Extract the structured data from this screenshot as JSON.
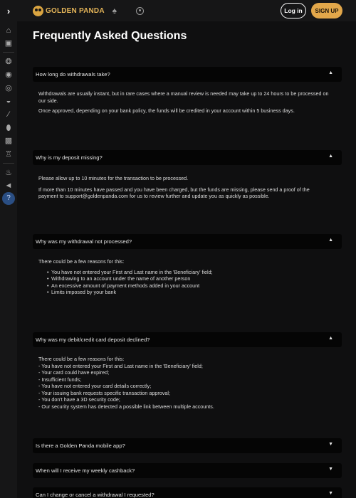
{
  "header": {
    "logo_text": "GOLDEN PANDA",
    "login_label": "Log in",
    "signup_label": "SIGN UP",
    "icons": [
      "chevron-right-icon",
      "spade-icon",
      "target-icon"
    ]
  },
  "sidebar": {
    "icons": [
      "house-icon",
      "casino-icon",
      "poker-chip-icon",
      "live-icon",
      "sports-icon",
      "basketball-icon",
      "hockey-icon",
      "football-icon",
      "robot-icon",
      "bank-icon",
      "fire-icon",
      "megaphone-icon",
      "help-icon"
    ],
    "active": "help-icon"
  },
  "page": {
    "title": "Frequently Asked Questions"
  },
  "faqs": [
    {
      "question": "How long do withdrawals take?",
      "expanded": true,
      "paragraphs": [
        "Withdrawals are usually instant, but in rare cases where a manual review is needed may take up to 24 hours to be processed on our side.",
        "Once approved, depending on your bank policy, the funds will be credited in your account within 5 business days."
      ]
    },
    {
      "question": "Why is my deposit missing?",
      "expanded": true,
      "paragraphs": [
        "Please allow up to 10 minutes for the transaction to be processed.",
        "If more than 10 minutes have passed and you have been charged, but the funds are missing, please send a proof of the payment to support@goldenpanda.com for us to review further and update you as quickly as possible."
      ]
    },
    {
      "question": "Why was my withdrawal not processed?",
      "expanded": true,
      "intro": "There could be a few reasons for this:",
      "bullets": [
        "You have not entered your First and Last name in the 'Beneficiary' field;",
        "Withdrawing to an account under the name of another person",
        "An excessive amount of payment methods added in your account",
        "Limits imposed by your bank"
      ]
    },
    {
      "question": "Why was my debit/credit card deposit declined?",
      "expanded": true,
      "intro": "There could be a few reasons for this:",
      "lines": [
        "- You have not entered your First and Last name in the 'Beneficiary' field;",
        "- Your card could have expired;",
        "- Insufficient funds;",
        "- You have not entered your card details correctly;",
        "- Your issuing bank requests specific transaction approval;",
        "- You don't have a 3D security code;",
        "- Our security system has detected a possible link between multiple accounts."
      ]
    },
    {
      "question": "Is there a Golden Panda mobile app?",
      "expanded": false
    },
    {
      "question": "When will I receive my weekly cashback?",
      "expanded": false
    },
    {
      "question": "Can I change or cancel a withdrawal I requested?",
      "expanded": false
    }
  ],
  "colors": {
    "accent": "#e2a74a",
    "logo": "#e6b659",
    "active_icon_bg": "#2a4e83",
    "background": "#0f0f10",
    "faq_header_bg": "#050505"
  }
}
